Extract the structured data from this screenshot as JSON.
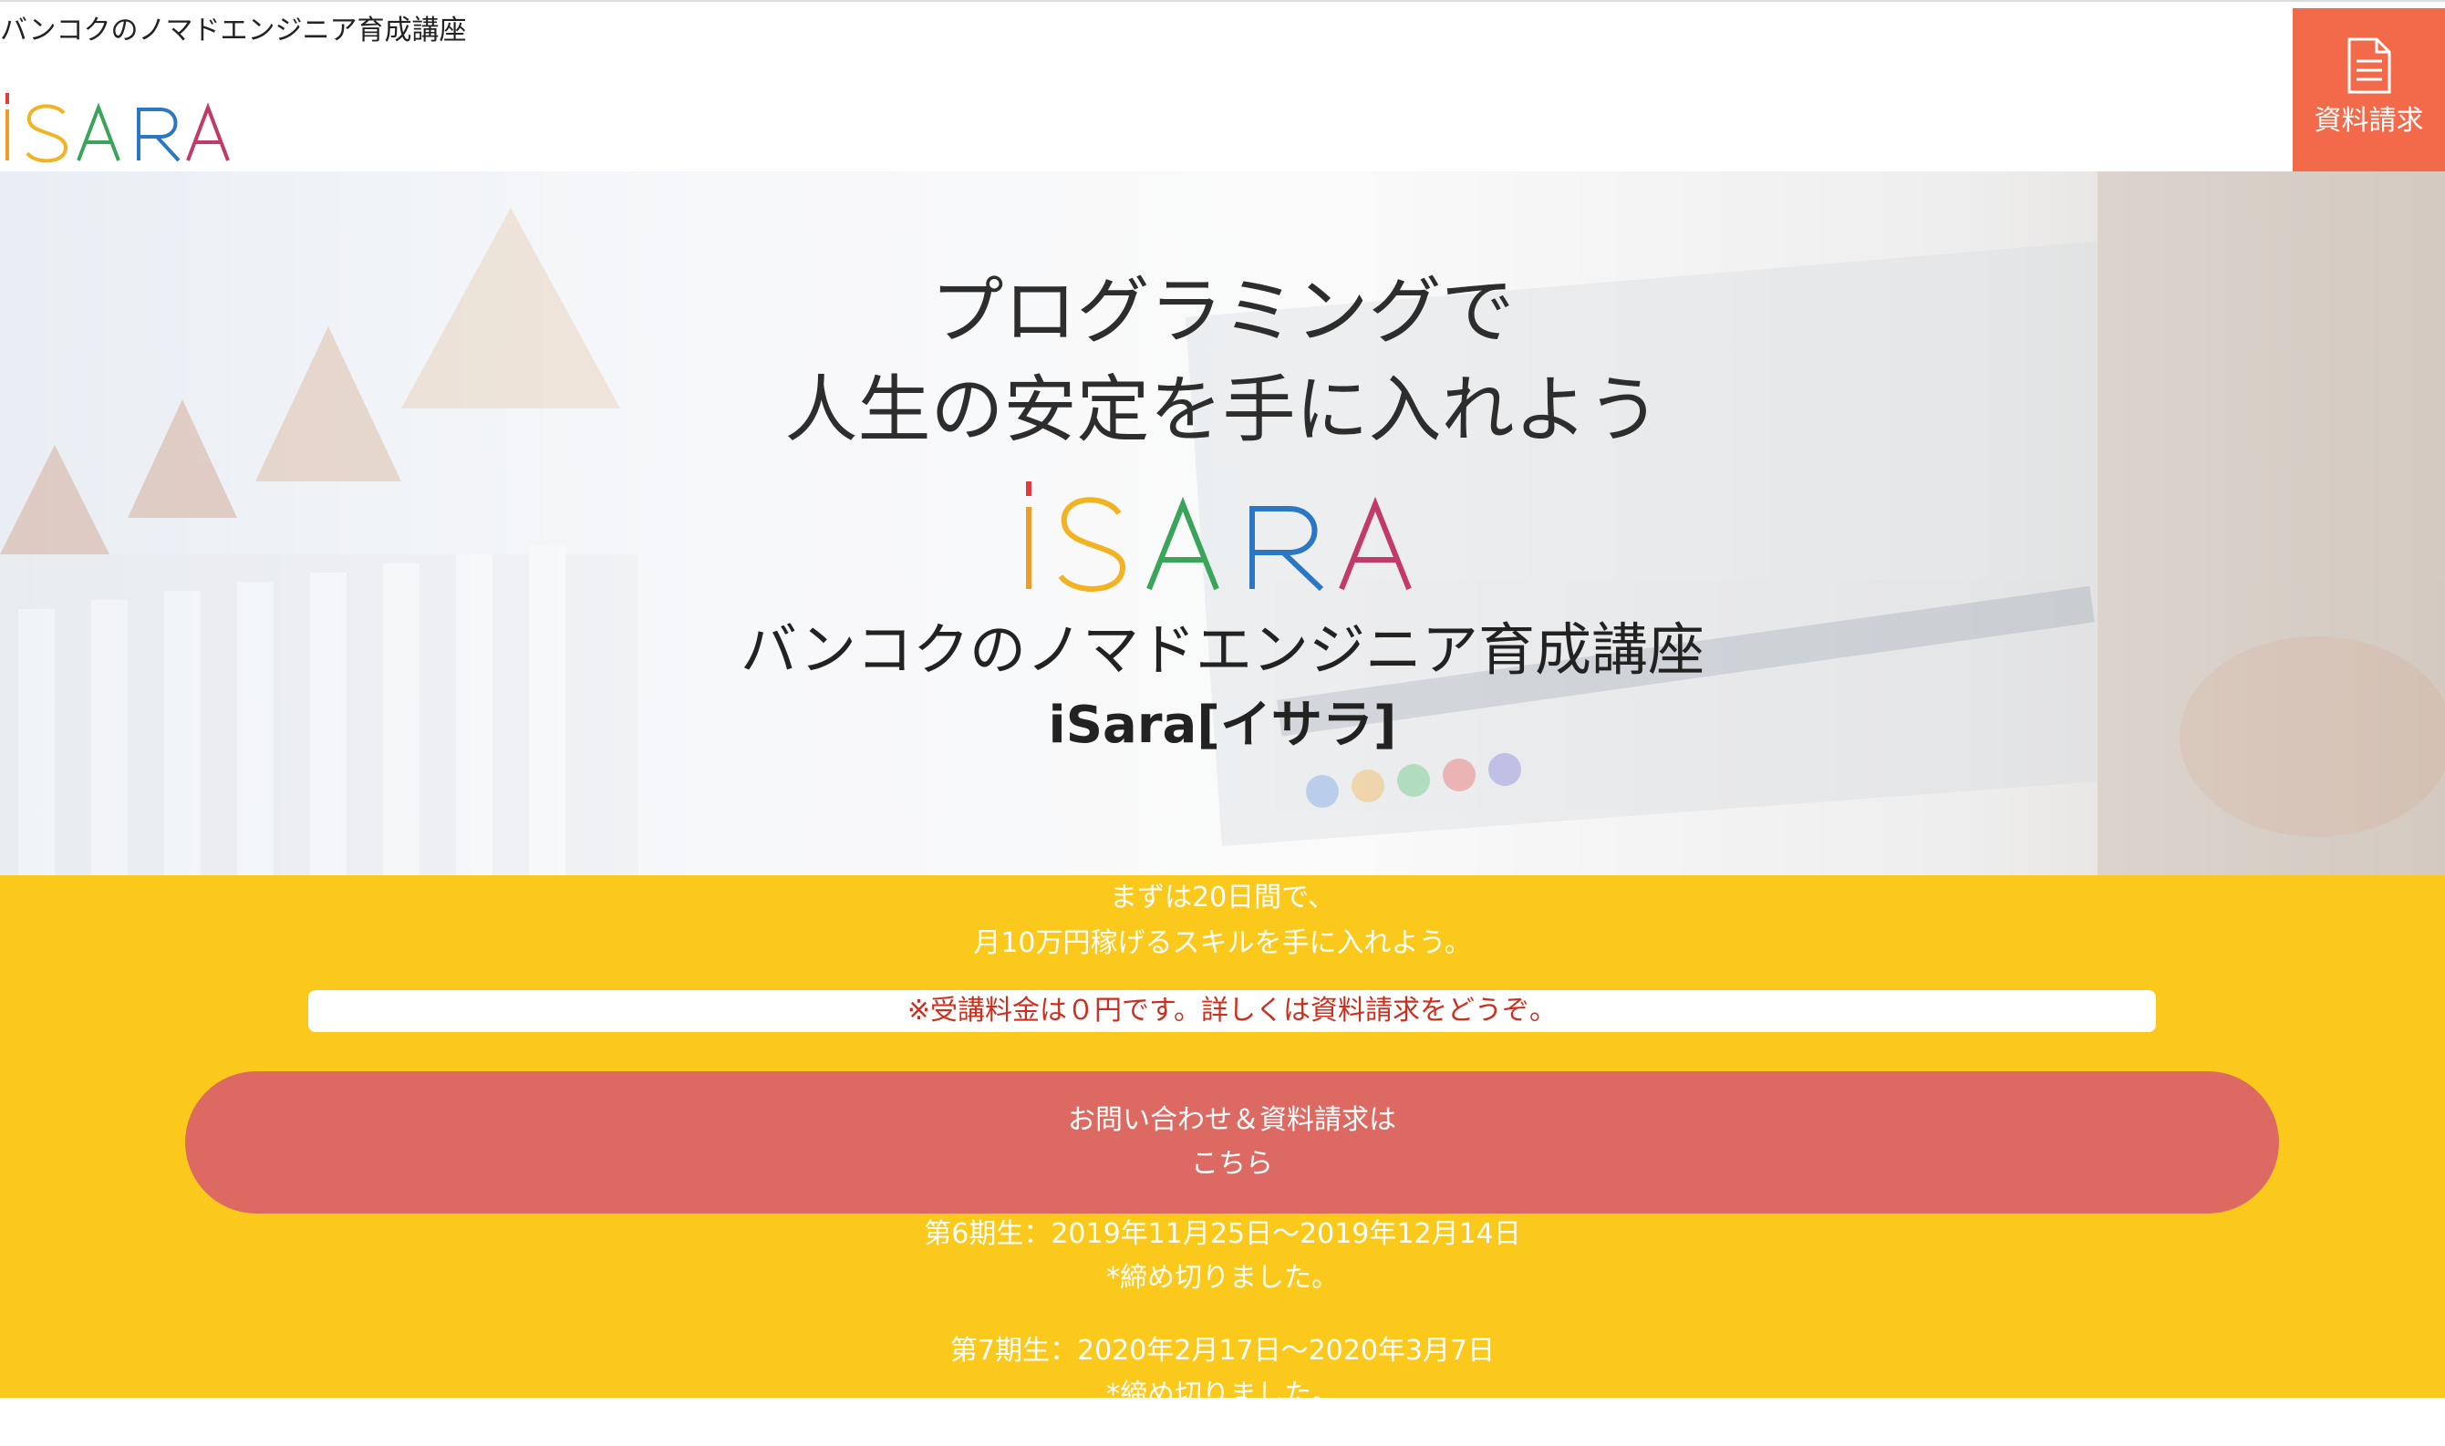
{
  "header": {
    "tagline": "バンコクのノマドエンジニア育成講座",
    "logo_text": "iSARA",
    "doc_button": {
      "label": "資料請求",
      "icon": "document-icon",
      "color": "#f26a4a"
    }
  },
  "hero": {
    "heading_line1": "プログラミングで",
    "heading_line2": "人生の安定を手に入れよう",
    "logo_text": "iSARA",
    "subtitle": "バンコクのノマドエンジニア育成講座",
    "name": "iSara[イサラ]"
  },
  "offer": {
    "intro_line1": "まずは20日間で、",
    "intro_line2": "月10万円稼げるスキルを手に入れよう。",
    "notice": "※受講料金は０円です。詳しくは資料請求をどうぞ。",
    "cta_line1": "お問い合わせ＆資料請求は",
    "cta_line2": "こちら",
    "background_color": "#fbc91b",
    "cta_color": "#dd6a62"
  },
  "schedule": [
    {
      "term": "第6期生：2019年11月25日〜2019年12月14日",
      "status": "*締め切りました。"
    },
    {
      "term": "第7期生：2020年2月17日〜2020年3月7日",
      "status": "*締め切りました。"
    }
  ]
}
